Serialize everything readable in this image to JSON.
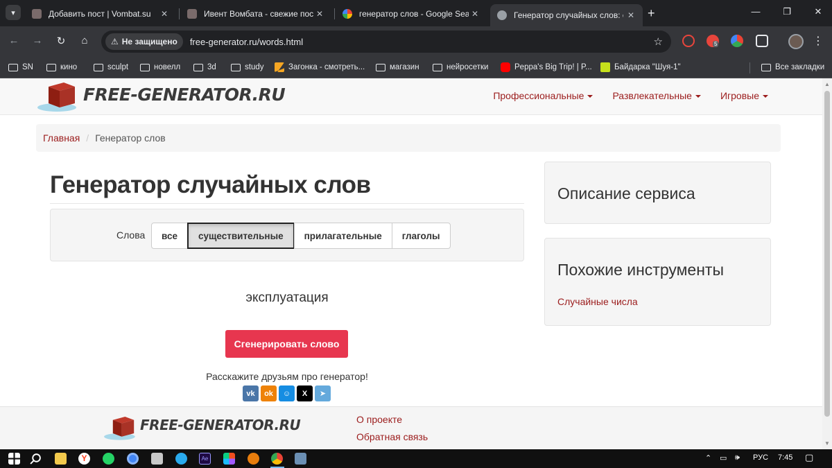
{
  "browser": {
    "tabs": [
      {
        "title": "Добавить пост | Vombat.su",
        "favicon": "wombat-favicon",
        "active": false
      },
      {
        "title": "Ивент Вомбата - свежие посты",
        "favicon": "wombat-favicon",
        "active": false
      },
      {
        "title": "генератор слов - Google Search",
        "favicon": "google-favicon",
        "active": false
      },
      {
        "title": "Генератор случайных слов: сущ",
        "favicon": "globe-favicon",
        "active": true
      }
    ],
    "security_label": "Не защищено",
    "url": "free-generator.ru/words.html",
    "extension_badge": "5",
    "bookmarks": [
      {
        "label": "SN",
        "type": "folder"
      },
      {
        "label": "кино",
        "type": "folder"
      },
      {
        "label": "sculpt",
        "type": "folder"
      },
      {
        "label": "новелл",
        "type": "folder"
      },
      {
        "label": "3d",
        "type": "folder"
      },
      {
        "label": "study",
        "type": "folder"
      },
      {
        "label": "Загонка - смотреть...",
        "type": "site"
      },
      {
        "label": "магазин",
        "type": "folder"
      },
      {
        "label": "нейросетки",
        "type": "folder"
      },
      {
        "label": "Peppa's Big Trip! | P...",
        "type": "site"
      },
      {
        "label": "Байдарка \"Шуя-1\"",
        "type": "site"
      }
    ],
    "all_bookmarks": "Все закладки"
  },
  "site": {
    "logo_text": "FREE-GENERATOR.RU",
    "nav": [
      "Профессиональные",
      "Развлекательные",
      "Игровые"
    ],
    "breadcrumb": {
      "home": "Главная",
      "separator": "/",
      "current": "Генератор слов"
    },
    "title": "Генератор случайных слов",
    "filter_label": "Слова",
    "filter_options": [
      "все",
      "существительные",
      "прилагательные",
      "глаголы"
    ],
    "filter_selected": "существительные",
    "result_word": "эксплуатация",
    "generate_button": "Сгенерировать слово",
    "share_text": "Расскажите друзьям про генератор!",
    "share_buttons": [
      {
        "name": "vk",
        "glyph": "vk",
        "color": "#4a76a8"
      },
      {
        "name": "odnoklassniki",
        "glyph": "ok",
        "color": "#ee8208"
      },
      {
        "name": "moimir",
        "glyph": "☺",
        "color": "#168de2"
      },
      {
        "name": "x",
        "glyph": "X",
        "color": "#000000"
      },
      {
        "name": "telegram",
        "glyph": "➤",
        "color": "#64a9dc"
      }
    ],
    "sidebar": {
      "description_title": "Описание сервиса",
      "similar_title": "Похожие инструменты",
      "similar_links": [
        "Случайные числа"
      ]
    },
    "footer": {
      "logo_text": "FREE-GENERATOR.RU",
      "links": [
        "О проекте",
        "Обратная связь"
      ]
    },
    "colors": {
      "link": "#9b1c1c",
      "generate_button": "#e7364f"
    }
  },
  "taskbar": {
    "language": "РУС",
    "time": "7:45"
  }
}
